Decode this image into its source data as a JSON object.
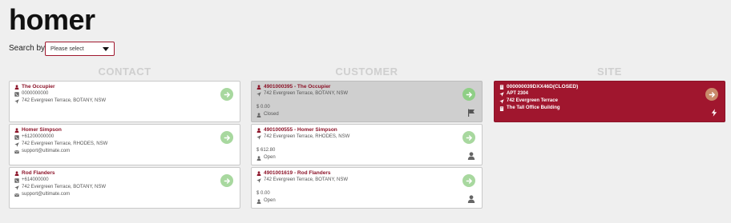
{
  "page": {
    "title": "homer"
  },
  "search": {
    "label": "Search by",
    "placeholder": "Please select"
  },
  "columns": {
    "contact": "CONTACT",
    "customer": "CUSTOMER",
    "site": "SITE"
  },
  "contacts": [
    {
      "name": "The Occupier",
      "phone": "0000000000",
      "address": "742 Evergreen Terrace, BOTANY, NSW",
      "email": ""
    },
    {
      "name": "Homer Simpson",
      "phone": "+61200000000",
      "address": "742 Evergreen Terrace, RHODES, NSW",
      "email": "support@ultimate.com"
    },
    {
      "name": "Rod Flanders",
      "phone": "+614000000",
      "address": "742 Evergreen Terrace, BOTANY, NSW",
      "email": "support@ultimate.com"
    }
  ],
  "customers": [
    {
      "name": "4901000395 - The Occupier",
      "address": "742 Evergreen Terrace, BOTANY, NSW",
      "balance": "$ 0.00",
      "status": "Closed"
    },
    {
      "name": "4901000555 - Homer Simpson",
      "address": "742 Evergreen Terrace, RHODES, NSW",
      "balance": "$ 612.80",
      "status": "Open"
    },
    {
      "name": "4901001619 - Rod Flanders",
      "address": "742 Evergreen Terrace, BOTANY, NSW",
      "balance": "$ 0.00",
      "status": "Open"
    }
  ],
  "sites": [
    {
      "name": "000000039DXX46D(CLOSED)",
      "unit": "APT 2304",
      "street": "742 Evergreen Terrace",
      "building": "The Tall Office Building"
    }
  ],
  "colors": {
    "brand": "#a0162e",
    "go_button": "#a8d89f",
    "closed_card": "#cfcfcf"
  },
  "icons": [
    "user-icon",
    "phone-icon",
    "location-arrow-icon",
    "envelope-icon",
    "arrow-right-icon",
    "flag-icon",
    "person-icon",
    "building-icon",
    "bolt-icon"
  ]
}
